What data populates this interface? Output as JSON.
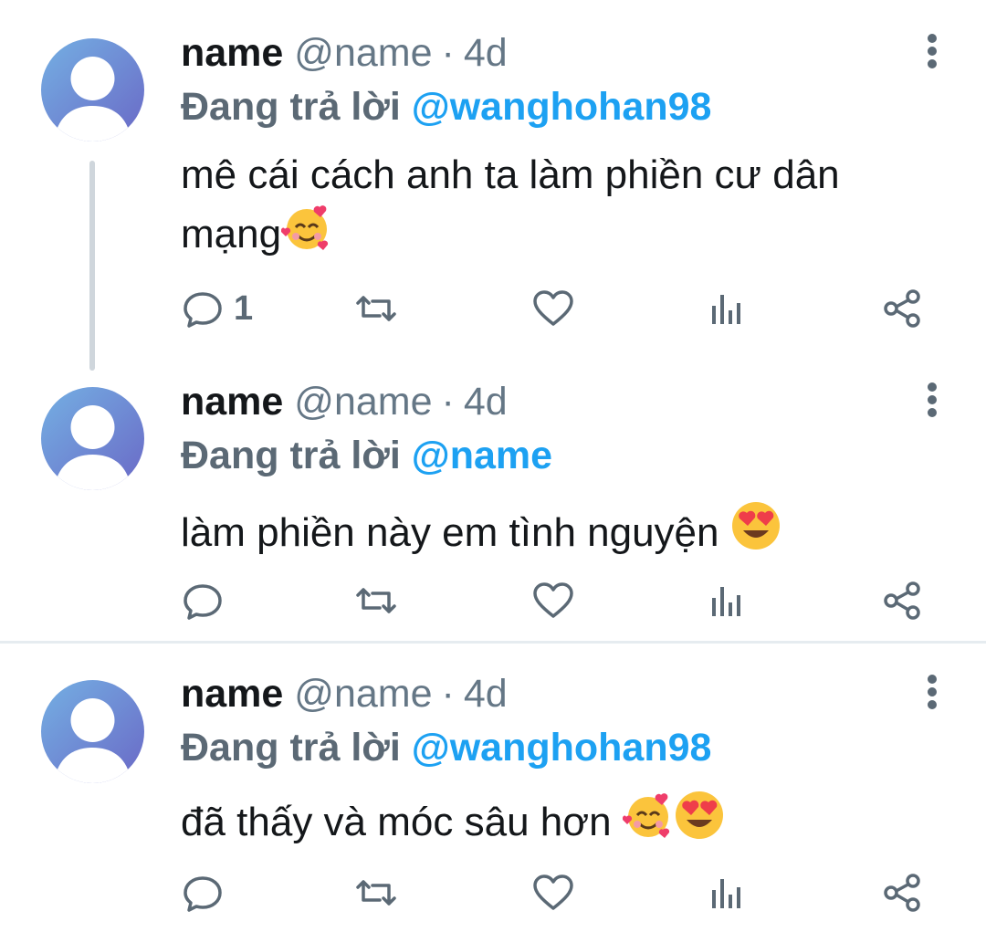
{
  "tweets": [
    {
      "display_name": "name",
      "handle": "@name",
      "separator": "·",
      "time": "4d",
      "replying_prefix": "Đang trả lời",
      "mention": "@wanghohan98",
      "text_line1": "mê cái cách anh ta làm phiền cư dân",
      "text_line2": "mạng",
      "emojis": [
        "smiling-face-with-hearts"
      ],
      "reply_count": "1"
    },
    {
      "display_name": "name",
      "handle": "@name",
      "separator": "·",
      "time": "4d",
      "replying_prefix": "Đang trả lời",
      "mention": "@name",
      "text": "làm phiền này em tình nguyện ",
      "emojis": [
        "heart-eyes"
      ],
      "reply_count": ""
    },
    {
      "display_name": "name",
      "handle": "@name",
      "separator": "·",
      "time": "4d",
      "replying_prefix": "Đang trả lời",
      "mention": "@wanghohan98",
      "text": "đã thấy và móc sâu hơn ",
      "emojis": [
        "smiling-face-with-hearts",
        "heart-eyes"
      ],
      "reply_count": ""
    }
  ],
  "colors": {
    "mention": "#1da1f2",
    "secondary_text": "#657786",
    "icon": "#5b6975",
    "avatar_from": "#6fa5dd",
    "avatar_to": "#6a6fc9"
  }
}
